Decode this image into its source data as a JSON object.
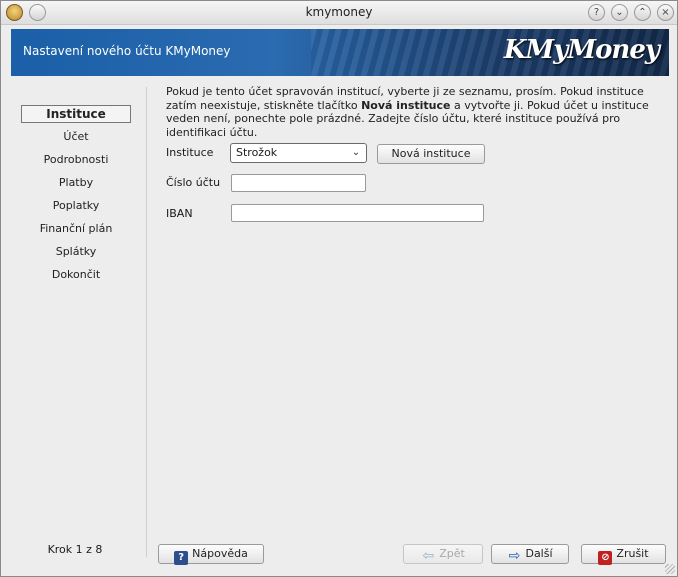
{
  "window": {
    "title": "kmymoney",
    "help_glyph": "?",
    "minimize_glyph": "⌄",
    "maximize_glyph": "⌃",
    "close_glyph": "×"
  },
  "banner": {
    "heading": "Nastavení nového účtu KMyMoney",
    "logo": "KMyMoney"
  },
  "sidebar": {
    "steps": [
      {
        "label": "Instituce",
        "active": true
      },
      {
        "label": "Účet"
      },
      {
        "label": "Podrobnosti"
      },
      {
        "label": "Platby"
      },
      {
        "label": "Poplatky"
      },
      {
        "label": "Finanční plán"
      },
      {
        "label": "Splátky"
      },
      {
        "label": "Dokončit"
      }
    ],
    "step_counter": "Krok 1 z 8"
  },
  "main": {
    "description_part1": "Pokud je tento účet spravován institucí, vyberte ji ze seznamu, prosím. Pokud instituce zatím neexistuje, stiskněte tlačítko ",
    "description_bold": "Nová instituce",
    "description_part2": " a vytvořte ji. Pokud účet u instituce veden není, ponechte pole prázdné. Zadejte číslo účtu, které instituce používá pro identifikaci účtu.",
    "institution_label": "Instituce",
    "institution_value": "Strožok",
    "new_institution_button": "Nová instituce",
    "account_number_label": "Číslo účtu",
    "account_number_value": "",
    "iban_label": "IBAN",
    "iban_value": ""
  },
  "footer": {
    "help_button": "Nápověda",
    "back_button": "Zpět",
    "next_button": "Další",
    "cancel_button": "Zrušit"
  },
  "icons": {
    "app": "kmymoney-app-icon",
    "pin": "pin-icon",
    "help": "help-icon",
    "minimize": "minimize-icon",
    "maximize": "maximize-icon",
    "close": "close-icon",
    "back": "arrow-left-icon",
    "next": "arrow-right-icon",
    "cancel": "cancel-icon"
  },
  "colors": {
    "banner_start": "#1a5fa8",
    "banner_end": "#12294a",
    "accent": "#1f5fb4"
  }
}
